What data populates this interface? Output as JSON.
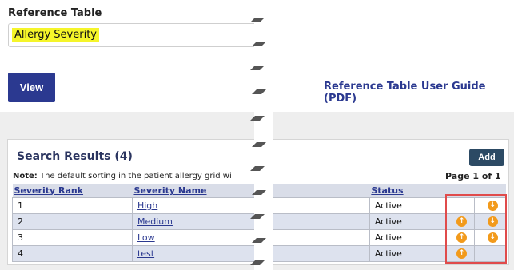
{
  "reference": {
    "label": "Reference Table",
    "value": "Allergy Severity",
    "view_label": "View",
    "guide_link": "Reference Table User Guide (PDF)"
  },
  "results": {
    "title": "Search Results (4)",
    "add_label": "Add",
    "note_bold": "Note:",
    "note_text": " The default sorting in the patient allergy grid wi",
    "page_info": "Page  1 of 1",
    "columns": {
      "rank": "Severity Rank",
      "name": "Severity Name",
      "status": "Status"
    },
    "rows": [
      {
        "rank": "1",
        "name": "High",
        "status": "Active",
        "up": false,
        "down": true
      },
      {
        "rank": "2",
        "name": "Medium",
        "status": "Active",
        "up": true,
        "down": true
      },
      {
        "rank": "3",
        "name": "Low",
        "status": "Active",
        "up": true,
        "down": true
      },
      {
        "rank": "4",
        "name": "test",
        "status": "Active",
        "up": true,
        "down": false
      }
    ]
  },
  "colors": {
    "primary_button": "#2b3990",
    "add_button": "#2c4a64",
    "highlight": "#f5f52a",
    "arrow": "#f29a1b",
    "annotation_box": "#e04b4b"
  },
  "icons": {
    "up": "arrow-up-icon",
    "down": "arrow-down-icon"
  }
}
